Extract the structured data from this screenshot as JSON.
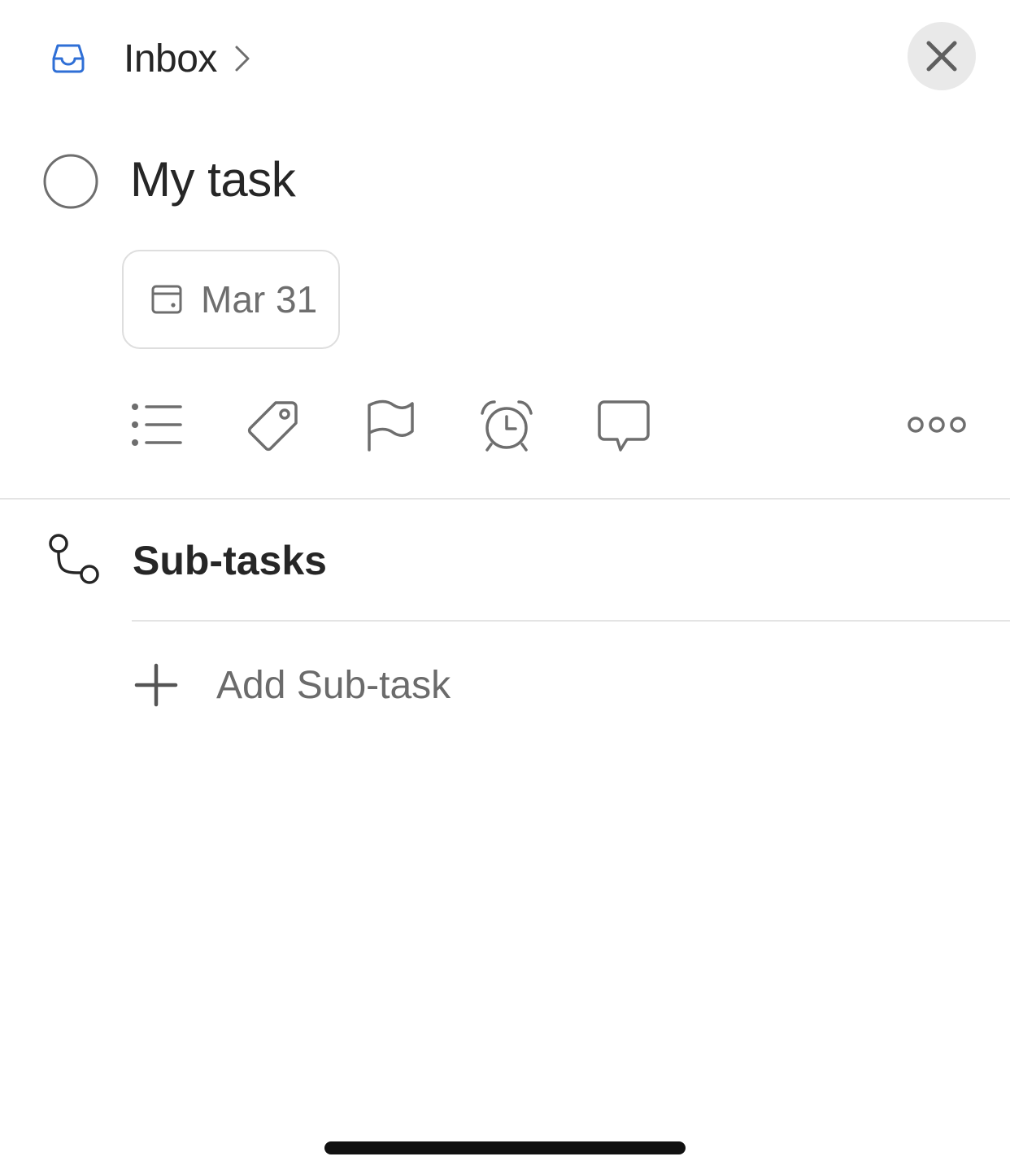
{
  "header": {
    "project_name": "Inbox",
    "icons": {
      "project": "inbox-icon",
      "chevron": "chevron-right-icon",
      "close": "close-icon"
    }
  },
  "task": {
    "title": "My task",
    "completed": false,
    "due_date": "Mar 31"
  },
  "toolbar": {
    "icons": [
      "list-icon",
      "tag-icon",
      "flag-icon",
      "alarm-icon",
      "comment-icon",
      "more-icon"
    ]
  },
  "subtasks": {
    "title": "Sub-tasks",
    "add_label": "Add Sub-task",
    "items": []
  },
  "colors": {
    "accent": "#2f6fd6",
    "icon_gray": "#6e6e6e",
    "divider": "#e4e4e4",
    "close_bg": "#e9e9e9"
  }
}
